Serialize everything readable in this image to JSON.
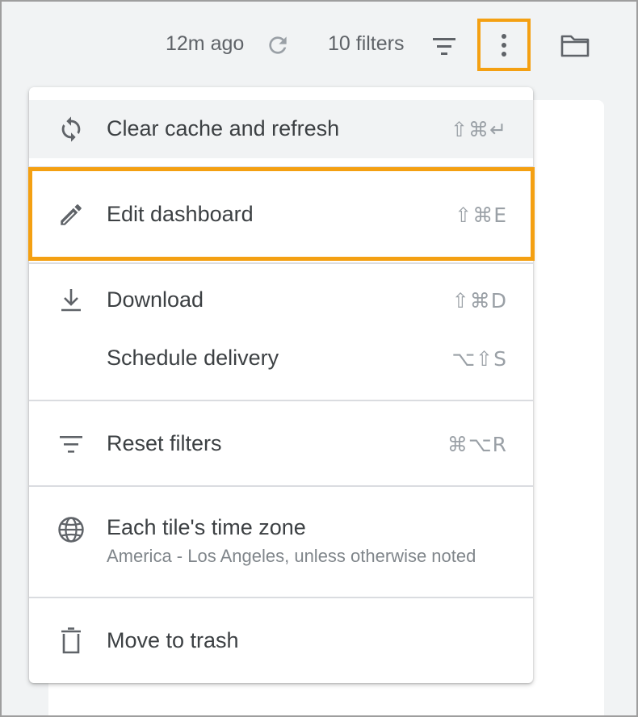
{
  "toolbar": {
    "updated_text": "12m ago",
    "filters_text": "10 filters",
    "refresh_icon": "refresh-icon",
    "filter_icon": "filter-list-icon",
    "more_icon": "more-vert-icon",
    "folder_icon": "folder-icon"
  },
  "menu": {
    "items": [
      {
        "label": "Clear cache and refresh",
        "shortcut": "⇧⌘↵",
        "icon": "sync-icon",
        "hovered": true
      },
      {
        "label": "Edit dashboard",
        "shortcut": "⇧⌘E",
        "icon": "pencil-icon"
      },
      {
        "label": "Download",
        "shortcut": "⇧⌘D",
        "icon": "download-icon"
      },
      {
        "label": "Schedule delivery",
        "shortcut": "⌥⇧S"
      },
      {
        "label": "Reset filters",
        "shortcut": "⌘⌥R",
        "icon": "filter-list-icon"
      },
      {
        "label": "Each tile's time zone",
        "sub": "America - Los Angeles, unless otherwise noted",
        "icon": "globe-icon"
      },
      {
        "label": "Move to trash",
        "icon": "trash-icon"
      }
    ]
  },
  "colors": {
    "highlight": "#f4a012",
    "hover_bg": "#f1f3f4",
    "text": "#3c4043",
    "muted": "#9aa0a6"
  }
}
